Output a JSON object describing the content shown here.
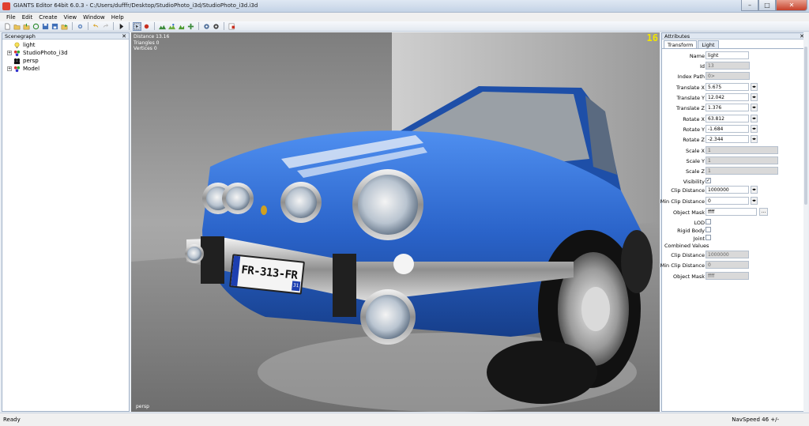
{
  "window": {
    "title": "GIANTS Editor 64bit 6.0.3 - C:/Users/dufffr/Desktop/StudioPhoto_i3d/StudioPhoto_i3d.i3d",
    "minimize": "–",
    "maximize": "□",
    "close": "✕"
  },
  "menu": [
    "File",
    "Edit",
    "Create",
    "View",
    "Window",
    "Help"
  ],
  "scenegraph": {
    "title": "Scenegraph",
    "close": "✕",
    "items": [
      {
        "label": "light",
        "icon": "light-bulb-icon",
        "expand": ""
      },
      {
        "label": "StudioPhoto_i3d",
        "icon": "transform-group-icon",
        "expand": "+"
      },
      {
        "label": "persp",
        "icon": "camera-icon",
        "expand": ""
      },
      {
        "label": "Model",
        "icon": "transform-group-icon",
        "expand": "+"
      }
    ]
  },
  "viewport": {
    "stats": [
      "Distance 13.16",
      "Triangles 0",
      "Vertices 0"
    ],
    "fps": "16",
    "camera": "persp",
    "plate": "FR-313-FR",
    "plate_dept": "31"
  },
  "attributes": {
    "title": "Attributes",
    "close": "✕",
    "tabs": [
      "Transform",
      "Light"
    ],
    "name_label": "Name",
    "name_value": "light",
    "id_label": "Id",
    "id_value": "13",
    "index_path_label": "Index Path",
    "index_path_value": "0>",
    "translate_x_label": "Translate X",
    "translate_x_value": "5.675",
    "translate_y_label": "Translate Y",
    "translate_y_value": "12.042",
    "translate_z_label": "Translate Z",
    "translate_z_value": "1.376",
    "rotate_x_label": "Rotate X",
    "rotate_x_value": "63.812",
    "rotate_y_label": "Rotate Y",
    "rotate_y_value": "-1.684",
    "rotate_z_label": "Rotate Z",
    "rotate_z_value": "-2.344",
    "scale_x_label": "Scale X",
    "scale_x_value": "1",
    "scale_y_label": "Scale Y",
    "scale_y_value": "1",
    "scale_z_label": "Scale Z",
    "scale_z_value": "1",
    "visibility_label": "Visibility",
    "visibility_check": "✓",
    "clip_distance_label": "Clip Distance",
    "clip_distance_value": "1000000",
    "min_clip_distance_label": "Min Clip Distance",
    "min_clip_distance_value": "0",
    "object_mask_label": "Object Mask",
    "object_mask_value": "ffff",
    "object_mask_button": "...",
    "lod_label": "LOD",
    "rigid_body_label": "Rigid Body",
    "joint_label": "Joint",
    "combined_values_label": "Combined Values",
    "combined_clip_distance_label": "Clip Distance",
    "combined_clip_distance_value": "1000000",
    "combined_min_clip_distance_label": "Min Clip Distance",
    "combined_min_clip_distance_value": "0",
    "combined_object_mask_label": "Object Mask",
    "combined_object_mask_value": "ffff",
    "spinner": "◂▸"
  },
  "status": {
    "left": "Ready",
    "right": "NavSpeed 46 +/-"
  },
  "colors": {
    "car_blue": "#2a63c9",
    "fps_yellow": "#f2e600",
    "panel_border": "#9fb0c6"
  }
}
